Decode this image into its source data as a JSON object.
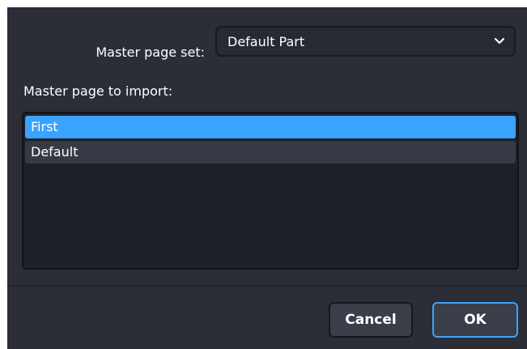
{
  "master_page_set": {
    "label": "Master page set:",
    "selected_value": "Default Part"
  },
  "import": {
    "label": "Master page to import:",
    "items": [
      {
        "label": "First",
        "selected": true
      },
      {
        "label": "Default",
        "selected": false
      }
    ]
  },
  "buttons": {
    "cancel_label": "Cancel",
    "ok_label": "OK"
  },
  "colors": {
    "background": "#2b2e37",
    "accent": "#3aa3ff",
    "list_background": "#1d2027",
    "item_background": "#363a45"
  },
  "icons": {
    "dropdown": "chevron-down-icon"
  }
}
